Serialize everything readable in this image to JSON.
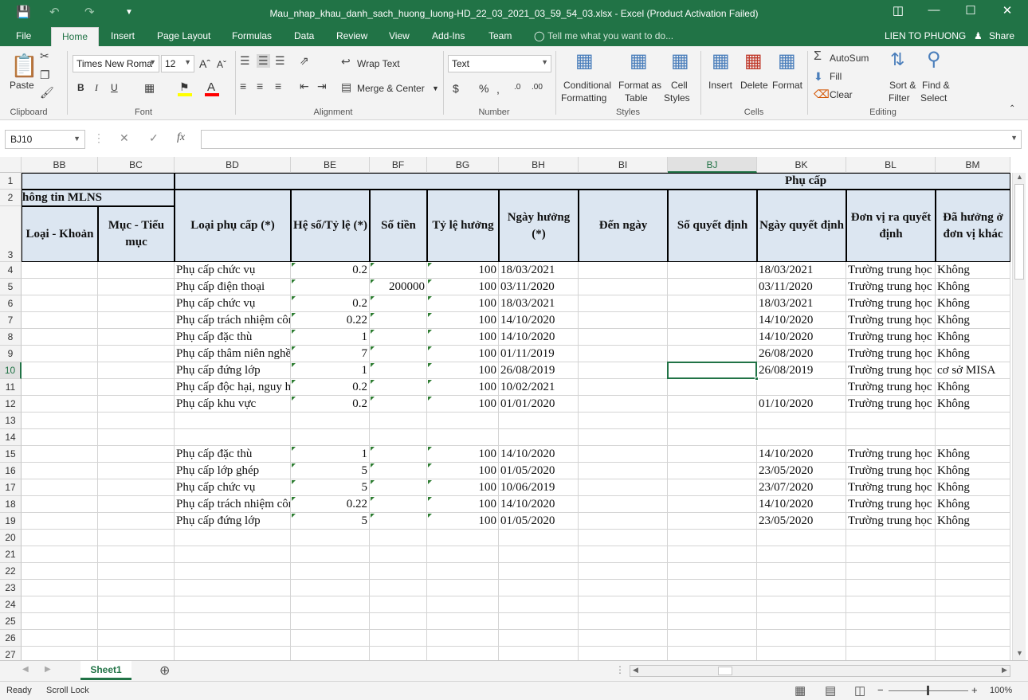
{
  "window": {
    "title": "Mau_nhap_khau_danh_sach_huong_luong-HD_22_03_2021_03_59_54_03.xlsx - Excel (Product Activation Failed)",
    "accent": "#217346"
  },
  "tabs": [
    "File",
    "Home",
    "Insert",
    "Page Layout",
    "Formulas",
    "Data",
    "Review",
    "View",
    "Add-Ins",
    "Team"
  ],
  "tell_me": "Tell me what you want to do...",
  "user": "LIEN TO PHUONG",
  "share": "Share",
  "ribbon": {
    "clipboard": {
      "paste": "Paste",
      "label": "Clipboard"
    },
    "font": {
      "name": "Times New Roma",
      "size": "12",
      "label": "Font"
    },
    "alignment": {
      "wrap": "Wrap Text",
      "merge": "Merge & Center",
      "label": "Alignment"
    },
    "number": {
      "format": "Text",
      "label": "Number"
    },
    "styles": {
      "cond1": "Conditional",
      "cond2": "Formatting",
      "fmt1": "Format as",
      "fmt2": "Table",
      "cell1": "Cell",
      "cell2": "Styles",
      "label": "Styles"
    },
    "cells": {
      "insert": "Insert",
      "delete": "Delete",
      "format": "Format",
      "label": "Cells"
    },
    "editing": {
      "autosum": "AutoSum",
      "fill": "Fill",
      "clear": "Clear",
      "sort1": "Sort &",
      "sort2": "Filter",
      "find1": "Find &",
      "find2": "Select",
      "label": "Editing"
    }
  },
  "namebox": "BJ10",
  "columns": [
    "BB",
    "BC",
    "BD",
    "BE",
    "BF",
    "BG",
    "BH",
    "BI",
    "BJ",
    "BK",
    "BL",
    "BM"
  ],
  "selected_column": "BJ",
  "selected_row": 10,
  "rows": [
    "1",
    "2",
    "3",
    "4",
    "5",
    "6",
    "7",
    "8",
    "9",
    "10",
    "11",
    "12",
    "13",
    "14",
    "15",
    "16",
    "17",
    "18",
    "19",
    "20",
    "21",
    "22",
    "23",
    "24",
    "25",
    "26",
    "27"
  ],
  "headers": {
    "phu_cap": "Phụ cấp",
    "mlns": "hông tin MLNS",
    "loai_khoan": "Loại - Khoản",
    "muc_tieu_muc": "Mục - Tiểu mục",
    "loai_phu_cap": "Loại phụ cấp (*)",
    "he_so": "Hệ số/Tỷ lệ (*)",
    "so_tien": "Số tiền",
    "ty_le": "Tỷ lệ hưởng",
    "ngay_huong": "Ngày hưởng (*)",
    "den_ngay": "Đến ngày",
    "so_qd": "Số quyết định",
    "ngay_qd": "Ngày quyết định",
    "don_vi": "Đơn vị ra quyết định",
    "da_huong": "Đã hưởng ở đơn vị khác"
  },
  "data_rows": [
    {
      "row": 4,
      "bd": "Phụ cấp chức vụ",
      "be": "0.2",
      "bf": "",
      "bg": "100",
      "bh": "18/03/2021",
      "bk": "18/03/2021",
      "bl": "Trường trung học",
      "bm": "Không"
    },
    {
      "row": 5,
      "bd": "Phụ cấp điện thoại",
      "be": "",
      "bf": "200000",
      "bg": "100",
      "bh": "03/11/2020",
      "bk": "03/11/2020",
      "bl": "Trường trung học",
      "bm": "Không"
    },
    {
      "row": 6,
      "bd": "Phụ cấp chức vụ",
      "be": "0.2",
      "bf": "",
      "bg": "100",
      "bh": "18/03/2021",
      "bk": "18/03/2021",
      "bl": "Trường trung học",
      "bm": "Không"
    },
    {
      "row": 7,
      "bd": "Phụ cấp trách nhiệm côn",
      "be": "0.22",
      "bf": "",
      "bg": "100",
      "bh": "14/10/2020",
      "bk": "14/10/2020",
      "bl": "Trường trung học",
      "bm": "Không"
    },
    {
      "row": 8,
      "bd": "Phụ cấp đặc thù",
      "be": "1",
      "bf": "",
      "bg": "100",
      "bh": "14/10/2020",
      "bk": "14/10/2020",
      "bl": "Trường trung học",
      "bm": "Không"
    },
    {
      "row": 9,
      "bd": "Phụ cấp thâm niên nghề",
      "be": "7",
      "bf": "",
      "bg": "100",
      "bh": "01/11/2019",
      "bk": "26/08/2020",
      "bl": "Trường trung học",
      "bm": "Không"
    },
    {
      "row": 10,
      "bd": "Phụ cấp đứng lớp",
      "be": "1",
      "bf": "",
      "bg": "100",
      "bh": "26/08/2019",
      "bk": "26/08/2019",
      "bl": "Trường trung học",
      "bm": "cơ sở MISA"
    },
    {
      "row": 11,
      "bd": "Phụ cấp độc hại, nguy h",
      "be": "0.2",
      "bf": "",
      "bg": "100",
      "bh": "10/02/2021",
      "bk": "",
      "bl": "Trường trung học",
      "bm": "Không"
    },
    {
      "row": 12,
      "bd": "Phụ cấp khu vực",
      "be": "0.2",
      "bf": "",
      "bg": "100",
      "bh": "01/01/2020",
      "bk": "01/10/2020",
      "bl": "Trường trung học",
      "bm": "Không"
    },
    {
      "row": 15,
      "bd": "Phụ cấp đặc thù",
      "be": "1",
      "bf": "",
      "bg": "100",
      "bh": "14/10/2020",
      "bk": "14/10/2020",
      "bl": "Trường trung học",
      "bm": "Không"
    },
    {
      "row": 16,
      "bd": "Phụ cấp lớp ghép",
      "be": "5",
      "bf": "",
      "bg": "100",
      "bh": "01/05/2020",
      "bk": "23/05/2020",
      "bl": "Trường trung học",
      "bm": "Không"
    },
    {
      "row": 17,
      "bd": "Phụ cấp chức vụ",
      "be": "5",
      "bf": "",
      "bg": "100",
      "bh": "10/06/2019",
      "bk": "23/07/2020",
      "bl": "Trường trung học",
      "bm": "Không"
    },
    {
      "row": 18,
      "bd": "Phụ cấp trách nhiệm côn",
      "be": "0.22",
      "bf": "",
      "bg": "100",
      "bh": "14/10/2020",
      "bk": "14/10/2020",
      "bl": "Trường trung học",
      "bm": "Không"
    },
    {
      "row": 19,
      "bd": "Phụ cấp đứng lớp",
      "be": "5",
      "bf": "",
      "bg": "100",
      "bh": "01/05/2020",
      "bk": "23/05/2020",
      "bl": "Trường trung học",
      "bm": "Không"
    }
  ],
  "sheet_tab": "Sheet1",
  "status": {
    "ready": "Ready",
    "scroll_lock": "Scroll Lock",
    "zoom": "100%"
  }
}
